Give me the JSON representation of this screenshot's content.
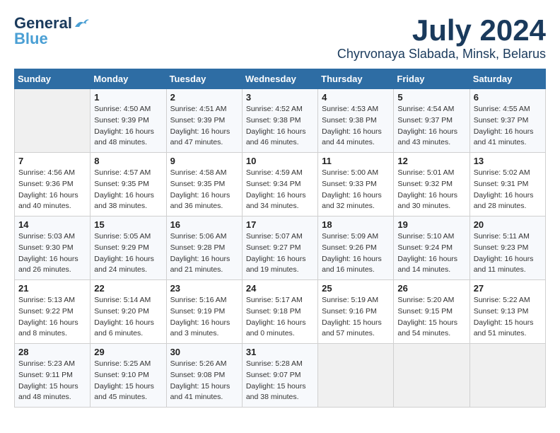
{
  "header": {
    "logo_line1": "General",
    "logo_line2": "Blue",
    "month_title": "July 2024",
    "location": "Chyrvonaya Slabada, Minsk, Belarus"
  },
  "days_of_week": [
    "Sunday",
    "Monday",
    "Tuesday",
    "Wednesday",
    "Thursday",
    "Friday",
    "Saturday"
  ],
  "weeks": [
    [
      {
        "day": "",
        "info": ""
      },
      {
        "day": "1",
        "info": "Sunrise: 4:50 AM\nSunset: 9:39 PM\nDaylight: 16 hours\nand 48 minutes."
      },
      {
        "day": "2",
        "info": "Sunrise: 4:51 AM\nSunset: 9:39 PM\nDaylight: 16 hours\nand 47 minutes."
      },
      {
        "day": "3",
        "info": "Sunrise: 4:52 AM\nSunset: 9:38 PM\nDaylight: 16 hours\nand 46 minutes."
      },
      {
        "day": "4",
        "info": "Sunrise: 4:53 AM\nSunset: 9:38 PM\nDaylight: 16 hours\nand 44 minutes."
      },
      {
        "day": "5",
        "info": "Sunrise: 4:54 AM\nSunset: 9:37 PM\nDaylight: 16 hours\nand 43 minutes."
      },
      {
        "day": "6",
        "info": "Sunrise: 4:55 AM\nSunset: 9:37 PM\nDaylight: 16 hours\nand 41 minutes."
      }
    ],
    [
      {
        "day": "7",
        "info": "Sunrise: 4:56 AM\nSunset: 9:36 PM\nDaylight: 16 hours\nand 40 minutes."
      },
      {
        "day": "8",
        "info": "Sunrise: 4:57 AM\nSunset: 9:35 PM\nDaylight: 16 hours\nand 38 minutes."
      },
      {
        "day": "9",
        "info": "Sunrise: 4:58 AM\nSunset: 9:35 PM\nDaylight: 16 hours\nand 36 minutes."
      },
      {
        "day": "10",
        "info": "Sunrise: 4:59 AM\nSunset: 9:34 PM\nDaylight: 16 hours\nand 34 minutes."
      },
      {
        "day": "11",
        "info": "Sunrise: 5:00 AM\nSunset: 9:33 PM\nDaylight: 16 hours\nand 32 minutes."
      },
      {
        "day": "12",
        "info": "Sunrise: 5:01 AM\nSunset: 9:32 PM\nDaylight: 16 hours\nand 30 minutes."
      },
      {
        "day": "13",
        "info": "Sunrise: 5:02 AM\nSunset: 9:31 PM\nDaylight: 16 hours\nand 28 minutes."
      }
    ],
    [
      {
        "day": "14",
        "info": "Sunrise: 5:03 AM\nSunset: 9:30 PM\nDaylight: 16 hours\nand 26 minutes."
      },
      {
        "day": "15",
        "info": "Sunrise: 5:05 AM\nSunset: 9:29 PM\nDaylight: 16 hours\nand 24 minutes."
      },
      {
        "day": "16",
        "info": "Sunrise: 5:06 AM\nSunset: 9:28 PM\nDaylight: 16 hours\nand 21 minutes."
      },
      {
        "day": "17",
        "info": "Sunrise: 5:07 AM\nSunset: 9:27 PM\nDaylight: 16 hours\nand 19 minutes."
      },
      {
        "day": "18",
        "info": "Sunrise: 5:09 AM\nSunset: 9:26 PM\nDaylight: 16 hours\nand 16 minutes."
      },
      {
        "day": "19",
        "info": "Sunrise: 5:10 AM\nSunset: 9:24 PM\nDaylight: 16 hours\nand 14 minutes."
      },
      {
        "day": "20",
        "info": "Sunrise: 5:11 AM\nSunset: 9:23 PM\nDaylight: 16 hours\nand 11 minutes."
      }
    ],
    [
      {
        "day": "21",
        "info": "Sunrise: 5:13 AM\nSunset: 9:22 PM\nDaylight: 16 hours\nand 8 minutes."
      },
      {
        "day": "22",
        "info": "Sunrise: 5:14 AM\nSunset: 9:20 PM\nDaylight: 16 hours\nand 6 minutes."
      },
      {
        "day": "23",
        "info": "Sunrise: 5:16 AM\nSunset: 9:19 PM\nDaylight: 16 hours\nand 3 minutes."
      },
      {
        "day": "24",
        "info": "Sunrise: 5:17 AM\nSunset: 9:18 PM\nDaylight: 16 hours\nand 0 minutes."
      },
      {
        "day": "25",
        "info": "Sunrise: 5:19 AM\nSunset: 9:16 PM\nDaylight: 15 hours\nand 57 minutes."
      },
      {
        "day": "26",
        "info": "Sunrise: 5:20 AM\nSunset: 9:15 PM\nDaylight: 15 hours\nand 54 minutes."
      },
      {
        "day": "27",
        "info": "Sunrise: 5:22 AM\nSunset: 9:13 PM\nDaylight: 15 hours\nand 51 minutes."
      }
    ],
    [
      {
        "day": "28",
        "info": "Sunrise: 5:23 AM\nSunset: 9:11 PM\nDaylight: 15 hours\nand 48 minutes."
      },
      {
        "day": "29",
        "info": "Sunrise: 5:25 AM\nSunset: 9:10 PM\nDaylight: 15 hours\nand 45 minutes."
      },
      {
        "day": "30",
        "info": "Sunrise: 5:26 AM\nSunset: 9:08 PM\nDaylight: 15 hours\nand 41 minutes."
      },
      {
        "day": "31",
        "info": "Sunrise: 5:28 AM\nSunset: 9:07 PM\nDaylight: 15 hours\nand 38 minutes."
      },
      {
        "day": "",
        "info": ""
      },
      {
        "day": "",
        "info": ""
      },
      {
        "day": "",
        "info": ""
      }
    ]
  ]
}
